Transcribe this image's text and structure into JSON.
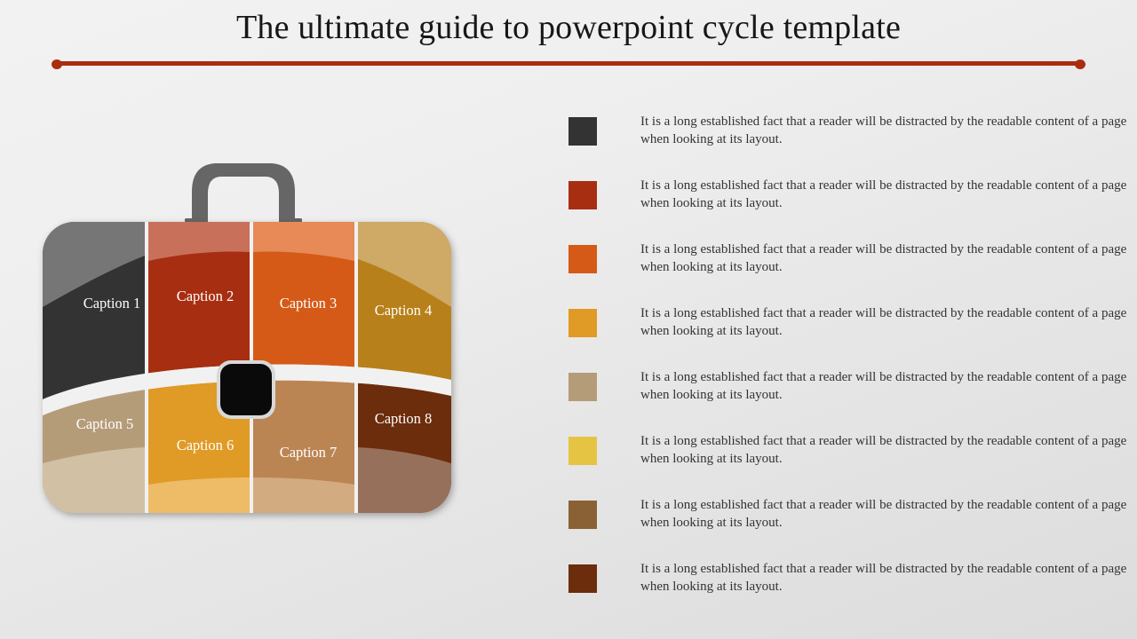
{
  "slide": {
    "title": "The ultimate guide to powerpoint cycle template",
    "background_top": "#f2f2f2",
    "background_bottom": "#dcdcdc",
    "divider_color": "#ab2d10"
  },
  "diagram": {
    "name": "briefcase-cycle-diagram",
    "handle_color": "#666666",
    "lock_color": "#0a0a0a",
    "lock_border_color": "#c9c9c9",
    "separator_color": "#f3f3f3",
    "panels": [
      {
        "caption": "Caption 1",
        "color": "#333333",
        "accent": "#767676",
        "row": "top",
        "col": 1
      },
      {
        "caption": "Caption 2",
        "color": "#a82e11",
        "accent": "#c9705a",
        "row": "top",
        "col": 2
      },
      {
        "caption": "Caption 3",
        "color": "#d55a17",
        "accent": "#e78a57",
        "row": "top",
        "col": 3
      },
      {
        "caption": "Caption 4",
        "color": "#b8801a",
        "accent": "#cfa966",
        "row": "top",
        "col": 4
      },
      {
        "caption": "Caption 5",
        "color": "#b59c79",
        "accent": "#d1c0a4",
        "row": "bottom",
        "col": 1
      },
      {
        "caption": "Caption 6",
        "color": "#e09a26",
        "accent": "#eebb67",
        "row": "bottom",
        "col": 2
      },
      {
        "caption": "Caption 7",
        "color": "#bb8553",
        "accent": "#d3ab80",
        "row": "bottom",
        "col": 3
      },
      {
        "caption": "Caption 8",
        "color": "#6b2d0b",
        "accent": "#97705c",
        "row": "bottom",
        "col": 4
      }
    ]
  },
  "legend": {
    "items": [
      {
        "color": "#333333",
        "text": "It is a long established fact that a reader will be distracted by the readable content of a page when looking at its layout."
      },
      {
        "color": "#a82e11",
        "text": "It is a long established fact that a reader will be distracted by the readable content of a page when looking at its layout."
      },
      {
        "color": "#d55a17",
        "text": "It is a long established fact that a reader will be distracted by the readable content of a page when looking at its layout."
      },
      {
        "color": "#e09a26",
        "text": "It is a long established fact that a reader will be distracted by the readable content of a page when looking at its layout."
      },
      {
        "color": "#b59c79",
        "text": "It is a long established fact that a reader will be distracted by the readable content of a page when looking at its layout."
      },
      {
        "color": "#e5c444",
        "text": "It is a long established fact that a reader will be distracted by the readable content of a page when looking at its layout."
      },
      {
        "color": "#8a6135",
        "text": "It is a long established fact that a reader will be distracted by the readable content of a page when looking at its layout."
      },
      {
        "color": "#6b2d0b",
        "text": "It is a long established fact that a reader will be distracted by the readable content of a page when looking at its layout."
      }
    ]
  }
}
